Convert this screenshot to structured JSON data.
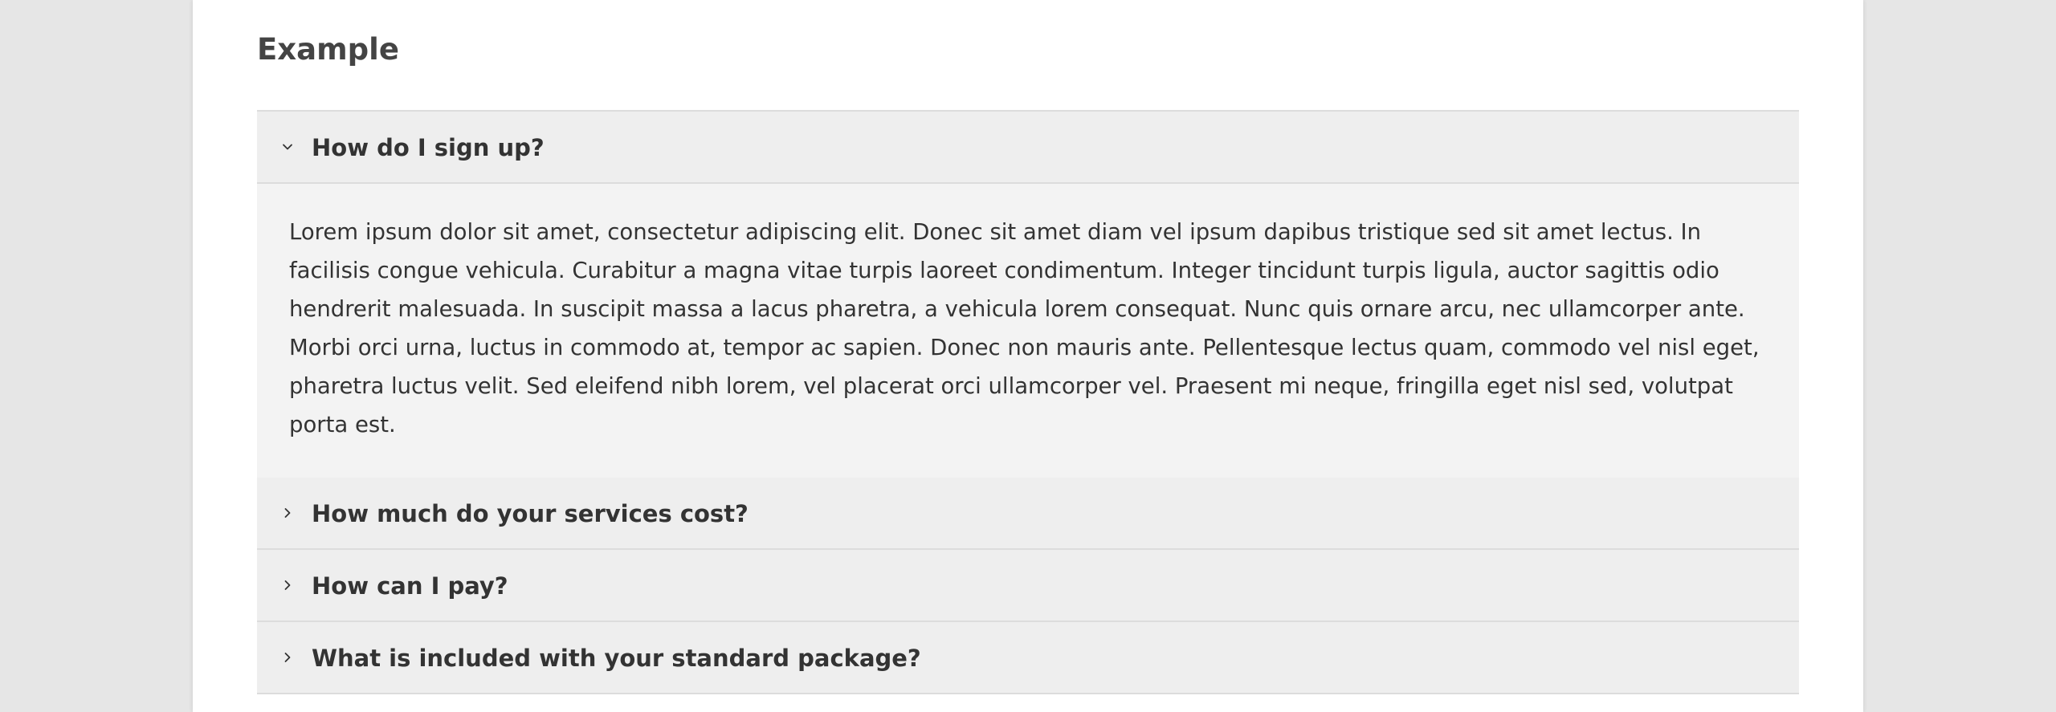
{
  "page": {
    "title": "Example"
  },
  "accordion": {
    "items": [
      {
        "question": "How do I sign up?",
        "expanded": true,
        "answer": "Lorem ipsum dolor sit amet, consectetur adipiscing elit. Donec sit amet diam vel ipsum dapibus tristique sed sit amet lectus. In facilisis congue vehicula. Curabitur a magna vitae turpis laoreet condimentum. Integer tincidunt turpis ligula, auctor sagittis odio hendrerit malesuada. In suscipit massa a lacus pharetra, a vehicula lorem consequat. Nunc quis ornare arcu, nec ullamcorper ante. Morbi orci urna, luctus in commodo at, tempor ac sapien. Donec non mauris ante. Pellentesque lectus quam, commodo vel nisl eget, pharetra luctus velit. Sed eleifend nibh lorem, vel placerat orci ullamcorper vel. Praesent mi neque, fringilla eget nisl sed, volutpat porta est."
      },
      {
        "question": "How much do your services cost?",
        "expanded": false
      },
      {
        "question": "How can I pay?",
        "expanded": false
      },
      {
        "question": "What is included with your standard package?",
        "expanded": false
      }
    ]
  },
  "icons": {
    "expanded": "chevron-down-icon",
    "collapsed": "chevron-right-icon"
  },
  "colors": {
    "page_background": "#e6e6e6",
    "card_background": "#ffffff",
    "header_background": "#eeeeee",
    "panel_background": "#f3f3f3",
    "border": "#dcdcdc",
    "title_text": "#444444",
    "body_text": "#333333"
  }
}
